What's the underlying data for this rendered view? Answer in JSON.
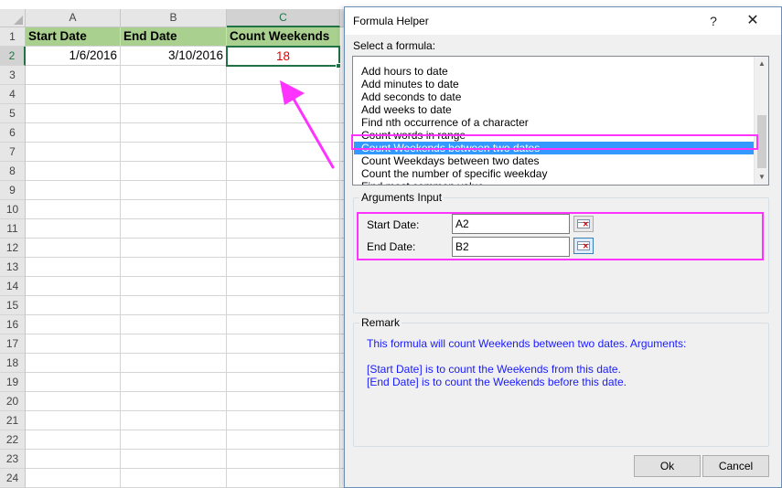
{
  "sheet": {
    "columns": [
      "A",
      "B",
      "C"
    ],
    "rows": [
      "1",
      "2",
      "3",
      "4",
      "5",
      "6",
      "7",
      "8",
      "9",
      "10",
      "11",
      "12",
      "13",
      "14",
      "15",
      "16",
      "17",
      "18",
      "19",
      "20",
      "21",
      "22",
      "23",
      "24"
    ],
    "headers": [
      "Start Date",
      "End Date",
      "Count Weekends"
    ],
    "values": [
      "1/6/2016",
      "3/10/2016",
      "18"
    ]
  },
  "dialog": {
    "title": "Formula Helper",
    "help_glyph": "?",
    "close_glyph": "✕",
    "select_label": "Select a formula:",
    "formulas": [
      "Add hours to date",
      "Add minutes to date",
      "Add seconds to date",
      "Add weeks to date",
      "Find nth occurrence of a character",
      "Count words in range",
      "Count Weekends between two dates",
      "Count Weekdays between two dates",
      "Count the number of specific weekday",
      "Find most common value"
    ],
    "selected_index": 6,
    "arguments_title": "Arguments Input",
    "args": [
      {
        "label": "Start Date:",
        "value": "A2"
      },
      {
        "label": "End Date:",
        "value": "B2"
      }
    ],
    "remark_title": "Remark",
    "remark_lines": [
      "This formula will count Weekends between two dates. Arguments:",
      "[Start Date] is to count the Weekends from this date.",
      "[End Date] is to count the Weekends before this date."
    ],
    "ok_label": "Ok",
    "cancel_label": "Cancel"
  },
  "colors": {
    "header_fill": "#a9d08e",
    "result_text": "#e00000",
    "highlight": "#ff33ff",
    "selection": "#3399ff",
    "remark_text": "#1a1aff"
  },
  "icons": {
    "range_selector": "range-select-icon",
    "annotation_arrow": "arrow-icon"
  }
}
